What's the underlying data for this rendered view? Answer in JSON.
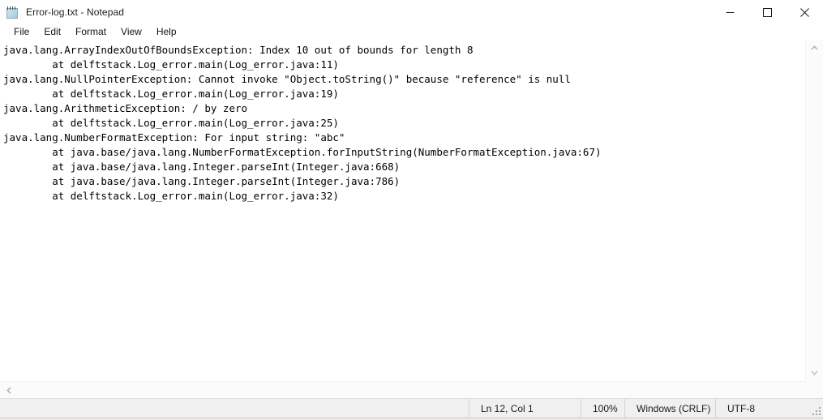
{
  "window": {
    "title": "Error-log.txt - Notepad",
    "icon": "notepad-icon",
    "controls": {
      "minimize": "minimize-icon",
      "maximize": "maximize-icon",
      "close": "close-icon"
    }
  },
  "menubar": {
    "items": [
      {
        "label": "File"
      },
      {
        "label": "Edit"
      },
      {
        "label": "Format"
      },
      {
        "label": "View"
      },
      {
        "label": "Help"
      }
    ]
  },
  "editor": {
    "lines": [
      "java.lang.ArrayIndexOutOfBoundsException: Index 10 out of bounds for length 8",
      "        at delftstack.Log_error.main(Log_error.java:11)",
      "java.lang.NullPointerException: Cannot invoke \"Object.toString()\" because \"reference\" is null",
      "        at delftstack.Log_error.main(Log_error.java:19)",
      "java.lang.ArithmeticException: / by zero",
      "        at delftstack.Log_error.main(Log_error.java:25)",
      "java.lang.NumberFormatException: For input string: \"abc\"",
      "        at java.base/java.lang.NumberFormatException.forInputString(NumberFormatException.java:67)",
      "        at java.base/java.lang.Integer.parseInt(Integer.java:668)",
      "        at java.base/java.lang.Integer.parseInt(Integer.java:786)",
      "        at delftstack.Log_error.main(Log_error.java:32)"
    ]
  },
  "scrollbars": {
    "vertical": {
      "up_arrow": "chevron-up-icon",
      "down_arrow": "chevron-down-icon"
    },
    "horizontal": {
      "left_arrow": "chevron-left-icon"
    }
  },
  "statusbar": {
    "position": "Ln 12, Col 1",
    "zoom": "100%",
    "line_ending": "Windows (CRLF)",
    "encoding": "UTF-8",
    "grip": "resize-grip-icon"
  },
  "colors": {
    "window_bg": "#ffffff",
    "text": "#000000",
    "statusbar_bg": "#f0f0f0",
    "scrollbar_bg": "#fbfbfb",
    "separator": "#d4d4d4"
  }
}
